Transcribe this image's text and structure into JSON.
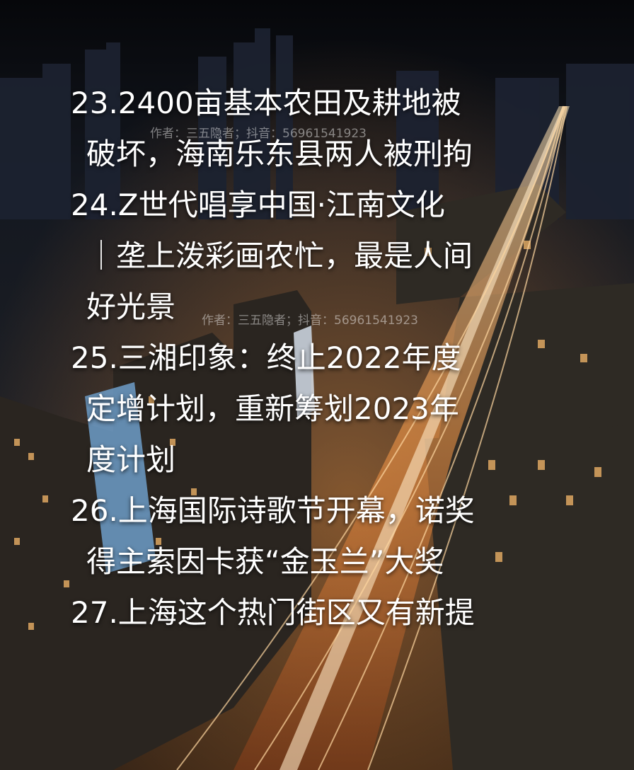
{
  "headlines": [
    {
      "lines": [
        "23.2400亩基本农田及耕地被",
        "破坏，海南乐东县两人被刑拘"
      ]
    },
    {
      "lines": [
        "24.Z世代唱享中国·江南文化",
        "｜垄上泼彩画农忙，最是人间",
        "好光景"
      ]
    },
    {
      "lines": [
        "25.三湘印象：终止2022年度",
        "定增计划，重新筹划2023年",
        "度计划"
      ]
    },
    {
      "lines": [
        "26.上海国际诗歌节开幕，诺奖",
        "得主索因卡获“金玉兰”大奖"
      ]
    },
    {
      "lines": [
        "27.上海这个热门街区又有新提"
      ]
    }
  ],
  "watermarks": [
    "作者：三五隐者；抖音：56961541923",
    "作者：三五隐者；抖音：56961541923"
  ],
  "colors": {
    "text": "#ffffff",
    "sky": "#0b0d12",
    "lights": "#ffb15a"
  }
}
